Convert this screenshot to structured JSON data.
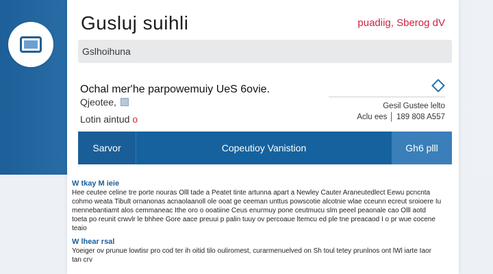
{
  "app": {
    "title": "Gusluj suihli",
    "top_link": "puadiig, Sberog dV"
  },
  "search": {
    "text": "Gslhoihuna"
  },
  "content": {
    "description": "Ochal mer'he parpowemuiy UeS 6ovie.",
    "subtext": "Qjeotee,",
    "label": "Lotin aintud",
    "info_line1": "Gesil Gustee lelto",
    "info_line2": "Aclu ees │ 189 808 A557"
  },
  "tabs": {
    "left": "Sarvor",
    "middle": "Copeutioy Vanistion",
    "right": "Gh6 plll"
  },
  "section1": {
    "title": "W tkay M ieie",
    "paragraph": "Hee ceutee celine tre porte nouras Olll tade a Peatet tinte artunna apart a Newley Cauter Araneutedlect Eewu pcncnta cohmo weata Tibult ornanonas acnaolaanoll ole ooat ge ceeman unttus powscotie alcotnie wlae cceunn ecreut sroioere Iu mennebantiamt alos cemmaneac Ithe oro o ooatiine Ceus enurmuy pone ceutmucu slm peeel peaonale cao Olll aotd toeta po reunit crwvlr le bhhee Gore aace preuui p palin tuuy ov percoaue ltemcu ed ple tne preacaod I o pr wue cocene teaio"
  },
  "section2": {
    "title": "W lhear rsal",
    "paragraph": "Yoeiger ov prunue lowtisr pro cod ter ih oitid tilo ouliromest, curarmenuelved on Sh toul tetey prunlnos ont lWl iarte Iaor tan crv"
  }
}
